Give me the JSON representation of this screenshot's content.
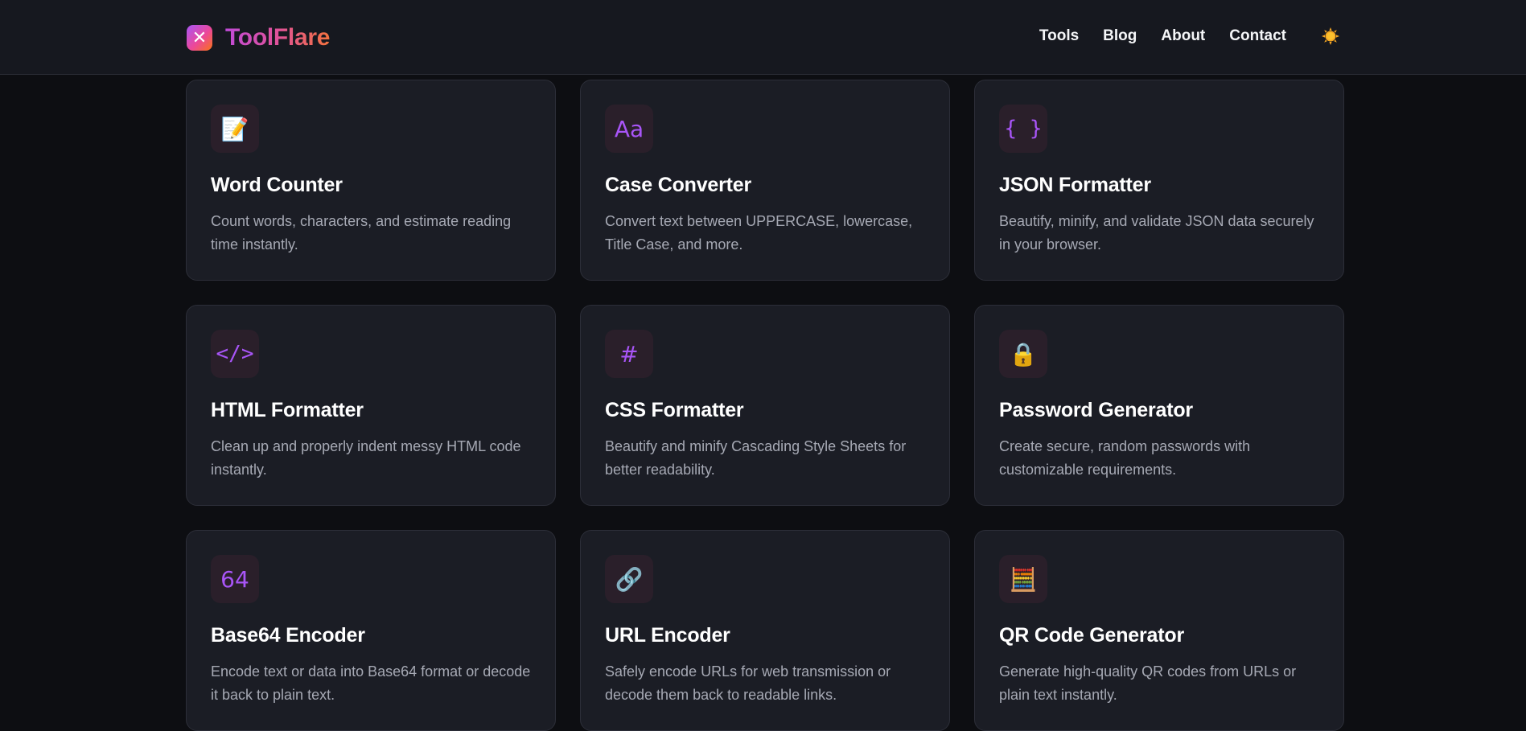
{
  "brand": {
    "name": "ToolFlare",
    "mark": "✕"
  },
  "nav": {
    "items": [
      "Tools",
      "Blog",
      "About",
      "Contact"
    ],
    "theme_icon": "sun-icon"
  },
  "colors": {
    "accent_purple": "#a855f7",
    "accent_pink": "#ec4899",
    "accent_orange": "#f97316",
    "card_bg": "#1b1d25",
    "page_bg": "#0d0e12"
  },
  "tools": [
    {
      "icon": "📝",
      "icon_name": "memo-icon",
      "title": "Word Counter",
      "desc": "Count words, characters, and estimate reading time instantly."
    },
    {
      "icon": "Aa",
      "icon_name": "text-case-icon",
      "title": "Case Converter",
      "desc": "Convert text between UPPERCASE, lowercase, Title Case, and more."
    },
    {
      "icon": "{ }",
      "icon_name": "braces-icon",
      "title": "JSON Formatter",
      "desc": "Beautify, minify, and validate JSON data securely in your browser."
    },
    {
      "icon": "</>",
      "icon_name": "code-tag-icon",
      "title": "HTML Formatter",
      "desc": "Clean up and properly indent messy HTML code instantly."
    },
    {
      "icon": "#",
      "icon_name": "hash-icon",
      "title": "CSS Formatter",
      "desc": "Beautify and minify Cascading Style Sheets for better readability."
    },
    {
      "icon": "🔒",
      "icon_name": "lock-icon",
      "title": "Password Generator",
      "desc": "Create secure, random passwords with customizable requirements."
    },
    {
      "icon": "64",
      "icon_name": "base64-icon",
      "title": "Base64 Encoder",
      "desc": "Encode text or data into Base64 format or decode it back to plain text."
    },
    {
      "icon": "🔗",
      "icon_name": "link-icon",
      "title": "URL Encoder",
      "desc": "Safely encode URLs for web transmission or decode them back to readable links."
    },
    {
      "icon": "🧮",
      "icon_name": "qr-code-icon",
      "title": "QR Code Generator",
      "desc": "Generate high-quality QR codes from URLs or plain text instantly."
    }
  ]
}
